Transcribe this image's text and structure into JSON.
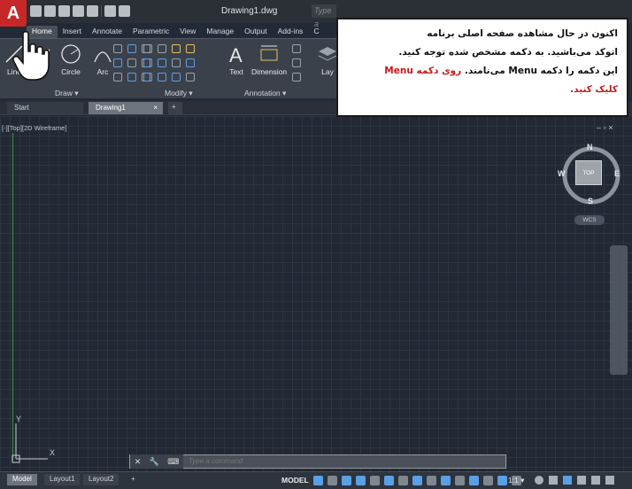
{
  "title_bar": {
    "app_logo": "A",
    "document_title": "Drawing1.dwg",
    "search_placeholder": "Type a"
  },
  "ribbon": {
    "tabs": [
      "Home",
      "Insert",
      "Annotate",
      "Parametric",
      "View",
      "Manage",
      "Output",
      "Add-ins",
      "C"
    ],
    "active_tab": "Home",
    "tools": {
      "line": "Line",
      "polyline": "me",
      "circle": "Circle",
      "arc": "Arc",
      "text": "Text",
      "dimension": "Dimension",
      "layers": "Lay"
    },
    "panels": {
      "draw": "Draw ▾",
      "modify": "Modify ▾",
      "annotation": "Annotation ▾"
    }
  },
  "file_tabs": {
    "start": "Start",
    "drawing": "Drawing1",
    "close": "×",
    "new": "+"
  },
  "callout": {
    "line1": "اکنون در حال مشاهده صفحه اصلی برنامه",
    "line2": "اتوکد می‌باشید. به دکمه مشخص شده توجه کنید.",
    "line3_part1": "این دکمه را دکمه ",
    "line3_menu": "Menu",
    "line3_part2": " می‌نامند. ",
    "line3_red": "روی دکمه ",
    "line3_red_menu": "Menu",
    "line4_red": "کلیک کنید."
  },
  "viewport": {
    "label": "[-][Top][2D Wireframe]",
    "controls": "–  ▫  ×",
    "ucs_y": "Y",
    "ucs_x": "X",
    "viewcube": {
      "face": "TOP",
      "n": "N",
      "s": "S",
      "e": "E",
      "w": "W",
      "wcs": "WCS"
    }
  },
  "command_line": {
    "close": "✕",
    "tools": "🔧",
    "prompt_icon": "⌨",
    "placeholder": "Type a command"
  },
  "status_bar": {
    "layout_tabs": [
      "Model",
      "Layout1",
      "Layout2"
    ],
    "add_layout": "+",
    "model_indicator": "MODEL",
    "scale": "1:1 ▾"
  },
  "colors": {
    "app_button": "#c62828",
    "callout_red": "#c31b1b",
    "ribbon_bg": "#3b414b",
    "viewport_bg": "#222935"
  }
}
